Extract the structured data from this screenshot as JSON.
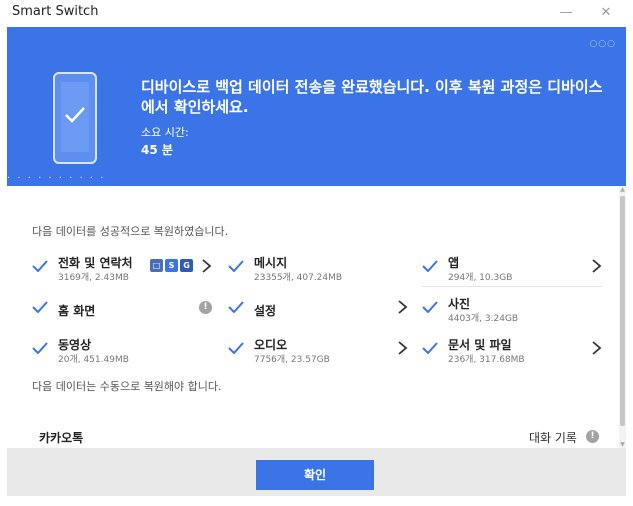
{
  "window": {
    "title": "Smart Switch",
    "minimize": "—",
    "close": "✕"
  },
  "banner": {
    "dots_top": "○○○",
    "dots_bottom": ". . . . . . . . . .",
    "headline": "디바이스로 백업 데이터 전송을 완료했습니다. 이후 복원 과정은 디바이스에서 확인하세요.",
    "time_label": "소요 시간:",
    "time_value": "45 분",
    "color": "#3b74e6"
  },
  "content": {
    "restored_heading": "다음 데이터를 성공적으로 복원하였습니다.",
    "manual_heading": "다음 데이터는 수동으로 복원해야 합니다.",
    "items": [
      {
        "name": "전화 및 연락처",
        "meta": "3169개, 2.43MB",
        "action": "chevron",
        "account_icons": [
          "□",
          "S",
          "G"
        ]
      },
      {
        "name": "메시지",
        "meta": "23355개, 407.24MB",
        "action": "none"
      },
      {
        "name": "앱",
        "meta": "294개, 10.3GB",
        "action": "chevron"
      },
      {
        "name": "홈 화면",
        "meta": "",
        "action": "info"
      },
      {
        "name": "설정",
        "meta": "",
        "action": "chevron"
      },
      {
        "name": "사진",
        "meta": "4403개, 3.24GB",
        "action": "none"
      },
      {
        "name": "동영상",
        "meta": "20개, 451.49MB",
        "action": "none"
      },
      {
        "name": "오디오",
        "meta": "7756개, 23.57GB",
        "action": "chevron"
      },
      {
        "name": "문서 및 파일",
        "meta": "236개, 317.68MB",
        "action": "chevron"
      }
    ],
    "manual": {
      "app": "카카오톡",
      "data": "대화 기록"
    },
    "info_glyph": "!"
  },
  "footer": {
    "ok_label": "확인"
  }
}
